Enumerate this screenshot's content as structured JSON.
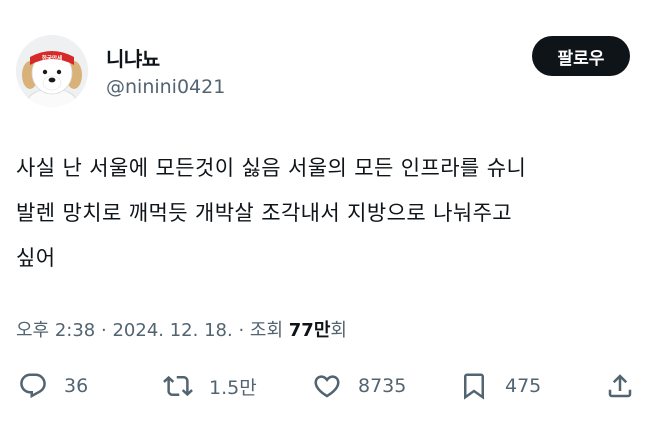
{
  "author": {
    "display_name": "니냐뇨",
    "handle": "@ninini0421",
    "avatar_icon": "dog-avatar",
    "avatar_band_text": "한국만세"
  },
  "follow_button_label": "팔로우",
  "tweet": {
    "lines": [
      "사실 난 서울에 모든것이 싫음 서울의 모든 인프라를 슈니",
      "발렌 망치로 깨먹듯 개박살 조각내서 지방으로 나눠주고",
      "싶어"
    ]
  },
  "meta": {
    "time": "오후 2:38",
    "separator": "·",
    "date": "2024. 12. 18.",
    "views_prefix": "조회",
    "views_count": "77만",
    "views_suffix": "회"
  },
  "actions": {
    "reply": {
      "icon": "reply-icon",
      "count": "36"
    },
    "retweet": {
      "icon": "retweet-icon",
      "count": "1.5만"
    },
    "like": {
      "icon": "heart-icon",
      "count": "8735"
    },
    "bookmark": {
      "icon": "bookmark-icon",
      "count": "475"
    },
    "share": {
      "icon": "share-icon"
    }
  },
  "colors": {
    "text_primary": "#0f1419",
    "text_secondary": "#536471",
    "button_bg": "#0f1419",
    "button_text": "#ffffff",
    "headband": "#d62a2a"
  }
}
